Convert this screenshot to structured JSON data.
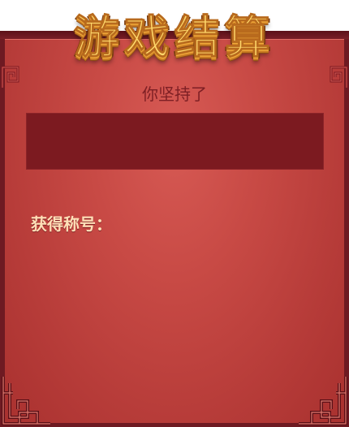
{
  "title": "游戏结算",
  "subtitle": "你坚持了",
  "time_value": "",
  "honor_label": "获得称号：",
  "honor_value": "",
  "colors": {
    "frame": "#6e1a22",
    "panel": "#c84a45",
    "time_box": "#7c1a20",
    "title_gold": "#ffd86b",
    "label_text": "#ffe0b8",
    "subtitle_text": "#7d1f24"
  }
}
